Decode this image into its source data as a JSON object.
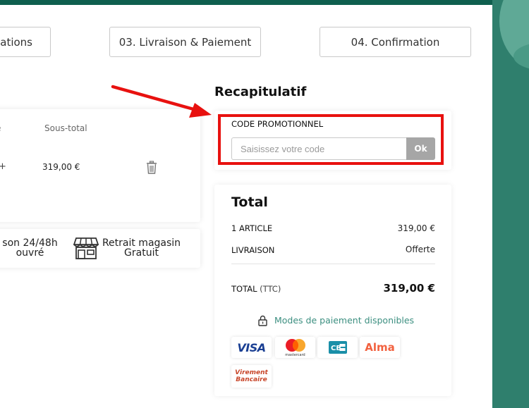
{
  "steps": {
    "step2_label": "ations",
    "step3_label": "03. Livraison & Paiement",
    "step4_label": "04. Confirmation"
  },
  "cart": {
    "qty_header": "é",
    "subtotal_header": "Sous-total",
    "qty_plus": "+",
    "item_price": "319,00 €"
  },
  "delivery": {
    "home_line1": "son 24/48h",
    "home_line2": "ouvré",
    "shop_line1": "Retrait magasin",
    "shop_line2": "Gratuit"
  },
  "recap": {
    "title": "Recapitulatif",
    "promo_label": "CODE PROMOTIONNEL",
    "promo_placeholder": "Saisissez votre code",
    "promo_button": "Ok"
  },
  "total": {
    "title": "Total",
    "articles_label": "1 ARTICLE",
    "articles_value": "319,00 €",
    "livraison_label": "LIVRAISON",
    "livraison_value": "Offerte",
    "ttc_label": "TOTAL",
    "ttc_sub": "(TTC)",
    "ttc_value": "319,00 €",
    "payment_link": "Modes de paiement disponibles"
  },
  "payment_logos": {
    "visa": "VISA",
    "mastercard": "mastercard",
    "alma": "Alma",
    "virement_line1": "Virement",
    "virement_line2": "Bancaire"
  },
  "colors": {
    "brand_dark": "#0f5f4e",
    "brand_panel": "#2f7f6d",
    "accent_link": "#3c8f80",
    "highlight_red": "#e8110f",
    "ok_button": "#a6a6a6"
  }
}
